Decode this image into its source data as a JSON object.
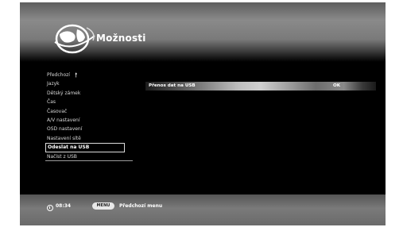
{
  "header": {
    "title": "Možnosti",
    "logo_icon": "globe-logo-icon"
  },
  "menu": {
    "items": [
      {
        "label": "Předchozí",
        "icon": "up-arrow-icon",
        "glyph": "🠕"
      },
      {
        "label": "Jazyk"
      },
      {
        "label": "Dětský zámek"
      },
      {
        "label": "Čas"
      },
      {
        "label": "Časovač"
      },
      {
        "label": "A/V nastavení"
      },
      {
        "label": "OSD nastavení"
      },
      {
        "label": "Nastavení sítě"
      },
      {
        "label": "Odeslat na USB",
        "selected": true
      },
      {
        "label": "Načíst z USB"
      }
    ]
  },
  "option": {
    "label": "Přenos dat na USB",
    "value": "OK"
  },
  "footer": {
    "time": "08:34",
    "menu_key": "MENU",
    "hint": "Předchozí menu",
    "clock_icon": "clock-icon"
  },
  "colors": {
    "background": "#000000",
    "text": "#ffffff",
    "selection_border": "#dcdcdc"
  }
}
